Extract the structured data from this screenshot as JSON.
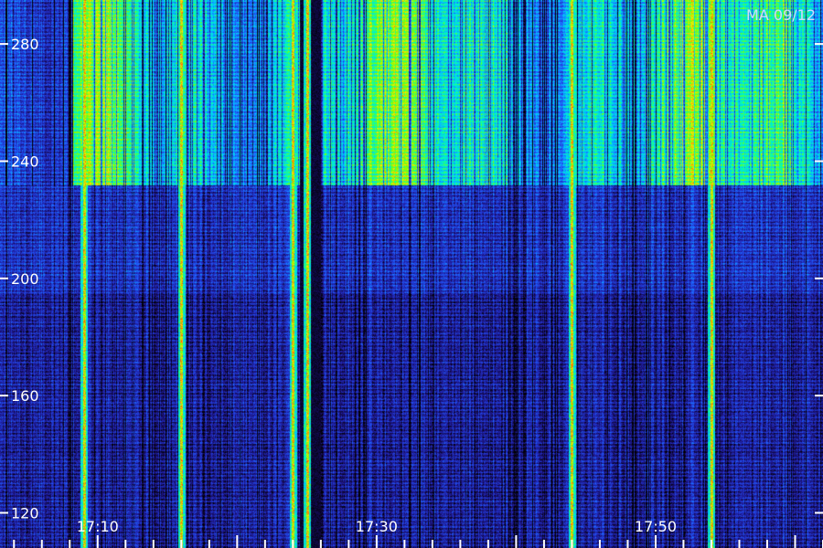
{
  "chart_data": {
    "type": "heatmap",
    "title": "",
    "corner_label": "MA 09/12",
    "xlabel": "",
    "ylabel": "",
    "x_ticks": [
      {
        "label": "17:10",
        "value": "17:10"
      },
      {
        "label": "17:30",
        "value": "17:30"
      },
      {
        "label": "17:50",
        "value": "17:50"
      }
    ],
    "x_range": [
      "17:03",
      "18:02"
    ],
    "x_minor_every_min": 2,
    "y_ticks": [
      {
        "label": "120",
        "value": 120
      },
      {
        "label": "160",
        "value": 160
      },
      {
        "label": "200",
        "value": 200
      },
      {
        "label": "240",
        "value": 240
      },
      {
        "label": "280",
        "value": 280
      }
    ],
    "ylim": [
      108,
      295
    ],
    "bands": [
      {
        "y_from": 232,
        "y_to": 295,
        "level": "high"
      },
      {
        "y_from": 195,
        "y_to": 232,
        "level": "medium"
      },
      {
        "y_from": 108,
        "y_to": 195,
        "level": "low"
      }
    ],
    "bright_columns_time": [
      "17:09",
      "17:16",
      "17:24",
      "17:25",
      "17:44",
      "17:54"
    ],
    "colormap": [
      "#000000",
      "#1a0f6e",
      "#2230c8",
      "#1e64ff",
      "#00c8ff",
      "#00ffb4",
      "#7dff00",
      "#ffe600",
      "#ff5000"
    ],
    "grid": false
  }
}
